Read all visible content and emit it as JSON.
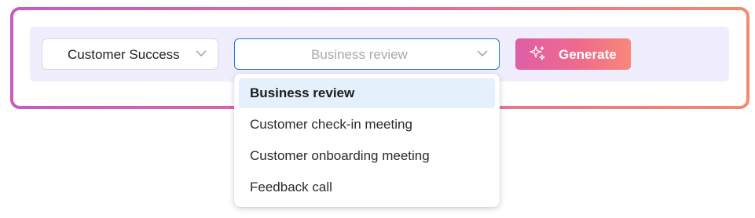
{
  "team_select": {
    "value": "Customer Success",
    "icon": "chevron-down-icon"
  },
  "template_select": {
    "value": "Business review",
    "icon": "chevron-down-icon",
    "focused": true
  },
  "generate_button": {
    "label": "Generate",
    "icon": "sparkle-icon"
  },
  "dropdown": {
    "options": [
      {
        "label": "Business review",
        "selected": true
      },
      {
        "label": "Customer check-in meeting",
        "selected": false
      },
      {
        "label": "Customer onboarding meeting",
        "selected": false
      },
      {
        "label": "Feedback call",
        "selected": false
      }
    ]
  },
  "colors": {
    "frame_gradient_start": "#c95bc0",
    "frame_gradient_end": "#f28a6e",
    "toolbar_background": "#f0eefd",
    "focus_border": "#1e78d4",
    "selected_option_background": "#e4f0fc",
    "button_gradient_start": "#dd5fa6",
    "button_gradient_end": "#f7887a"
  }
}
